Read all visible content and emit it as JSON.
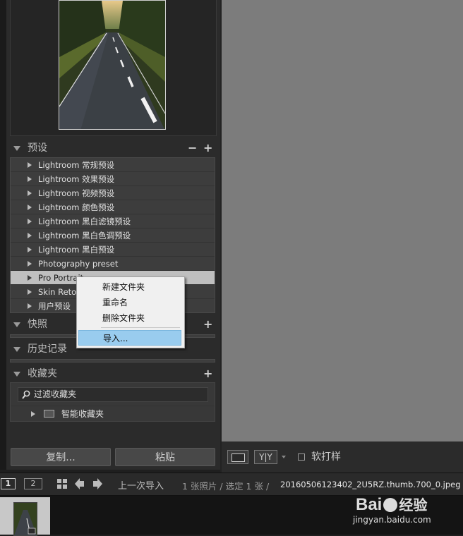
{
  "presets_panel": {
    "title": "预设",
    "minus": "−",
    "plus": "+",
    "items": [
      {
        "label": "Lightroom 常规预设"
      },
      {
        "label": "Lightroom 效果预设"
      },
      {
        "label": "Lightroom 视频预设"
      },
      {
        "label": "Lightroom 颜色预设"
      },
      {
        "label": "Lightroom 黑白滤镜预设"
      },
      {
        "label": "Lightroom 黑白色调预设"
      },
      {
        "label": "Lightroom 黑白预设"
      },
      {
        "label": "Photography preset"
      },
      {
        "label": "Pro Portrait"
      },
      {
        "label": "Skin Retou"
      },
      {
        "label": "用户预设"
      }
    ]
  },
  "snapshots_panel": {
    "title": "快照",
    "plus": "+"
  },
  "history_panel": {
    "title": "历史记录"
  },
  "collections_panel": {
    "title": "收藏夹",
    "plus": "+",
    "filter_placeholder": "过滤收藏夹",
    "smart_collection": "智能收藏夹"
  },
  "left_buttons": {
    "copy": "复制...",
    "paste": "粘贴"
  },
  "context_menu": {
    "items": [
      "新建文件夹",
      "重命名",
      "删除文件夹",
      "导入..."
    ],
    "highlighted_index": 3
  },
  "toolbar": {
    "yy": "Y|Y",
    "soft_proof": "软打样"
  },
  "filmstrip_bar": {
    "screen1": "1",
    "screen2": "2",
    "source": "上一次导入",
    "count": "1 张照片 / 选定 1 张 /",
    "filename": "20160506123402_2U5RZ.thumb.700_0.jpeg"
  },
  "watermark": {
    "brand": "Bai",
    "brand2": "经验",
    "url": "jingyan.baidu.com"
  },
  "colors": {
    "menu_highlight": "#99ccee",
    "selected_row": "#bfbfbf",
    "center_bg": "#7c7c7c"
  }
}
